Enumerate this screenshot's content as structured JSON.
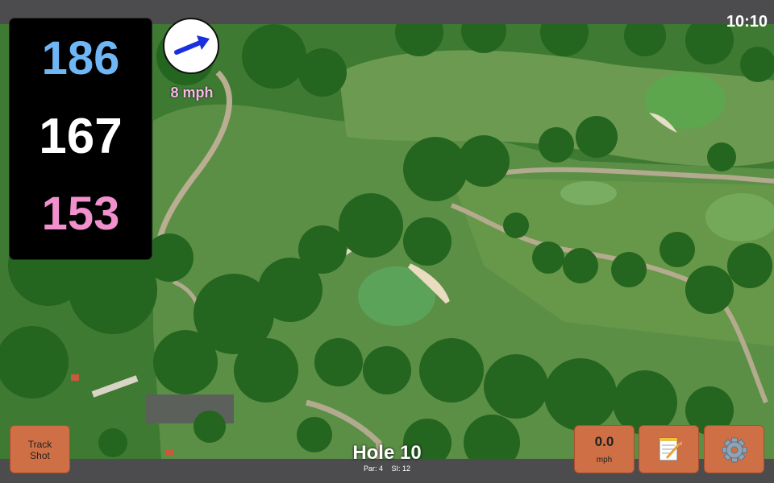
{
  "status": {
    "clock": "10:10"
  },
  "distances": {
    "back": "186",
    "middle": "167",
    "front": "153"
  },
  "wind": {
    "speed": "8 mph",
    "direction_icon": "arrow-icon"
  },
  "buttons": {
    "track_shot_line1": "Track",
    "track_shot_line2": "Shot",
    "speed_value": "0.0",
    "speed_unit": "mph",
    "notes_icon": "notepad-icon",
    "settings_icon": "gear-icon"
  },
  "hole": {
    "title": "Hole 10",
    "par": "Par: 4",
    "si": "SI: 12"
  },
  "colors": {
    "back_distance": "#6fb6f5",
    "middle_distance": "#ffffff",
    "front_distance": "#f28fcd",
    "wind_text": "#f7b8ea",
    "button_bg": "#cf6f45",
    "bar_bg": "#4c4c4e"
  }
}
